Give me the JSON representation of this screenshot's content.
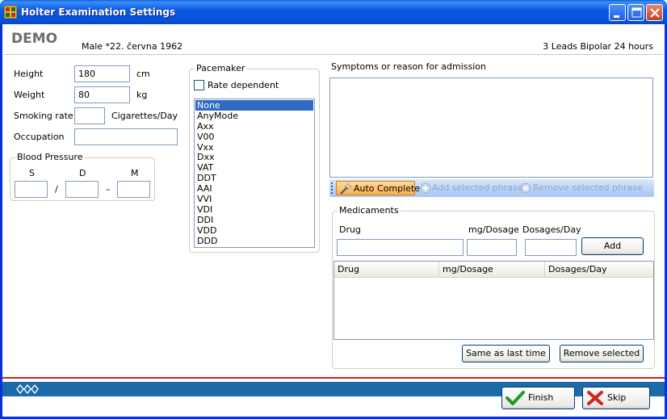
{
  "window": {
    "title": "Holter Examination Settings"
  },
  "patient": {
    "name": "DEMO",
    "info": "Male  *22. června 1962",
    "recording": "3 Leads Bipolar  24 hours"
  },
  "form": {
    "height": {
      "label": "Height",
      "value": "180",
      "unit": "cm"
    },
    "weight": {
      "label": "Weight",
      "value": "80",
      "unit": "kg"
    },
    "smoking": {
      "label": "Smoking rate",
      "value": "",
      "unit": "Cigarettes/Day"
    },
    "occupation": {
      "label": "Occupation",
      "value": ""
    },
    "blood_pressure": {
      "title": "Blood Pressure",
      "s_label": "S",
      "d_label": "D",
      "m_label": "M",
      "slash": "/",
      "dash": "–",
      "s": "",
      "d": "",
      "m": ""
    }
  },
  "pacemaker": {
    "title": "Pacemaker",
    "rate_dependent_label": "Rate dependent",
    "rate_dependent": false,
    "selected": "None",
    "modes": [
      "None",
      "AnyMode",
      "Axx",
      "V00",
      "Vxx",
      "Dxx",
      "VAT",
      "DDT",
      "AAI",
      "VVI",
      "VDI",
      "DDI",
      "VDD",
      "DDD"
    ]
  },
  "symptoms": {
    "label": "Symptoms or reason for admission",
    "value": "",
    "toolbar": {
      "auto_complete": "Auto Complete",
      "add_phrase": "Add selected phrase",
      "remove_phrase": "Remove selected phrase"
    }
  },
  "medicaments": {
    "title": "Medicaments",
    "drug_label": "Drug",
    "dosage_label": "mg/Dosage",
    "per_day_label": "Dosages/Day",
    "drug": "",
    "dosage": "",
    "per_day": "",
    "add_button": "Add",
    "columns": [
      "Drug",
      "mg/Dosage",
      "Dosages/Day"
    ],
    "rows": [],
    "same_as_last_button": "Same as last time",
    "remove_selected_button": "Remove selected"
  },
  "footer": {
    "finish_button": "Finish",
    "skip_button": "Skip"
  },
  "colors": {
    "titlebar": "#0a5fd8",
    "accent_red": "#c6282b",
    "statusbar": "#1c6aa8",
    "selection": "#316ac5"
  }
}
